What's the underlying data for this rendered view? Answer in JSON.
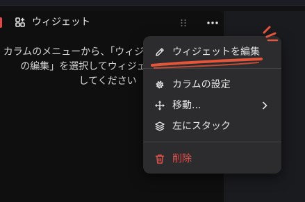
{
  "column": {
    "title": "ウィジェット",
    "message_line1": "カラムのメニューから、「ウィジェットを編集」",
    "message_line2": "の編集」を選択してウィジェットを追加",
    "message_line3": "してください"
  },
  "menu": {
    "items": [
      {
        "label": "ウィジェットを編集",
        "icon": "pencil-icon"
      },
      {
        "label": "カラムの設定",
        "icon": "gear-icon"
      },
      {
        "label": "移動...",
        "icon": "move-arrows-icon"
      },
      {
        "label": "左にスタック",
        "icon": "layers-icon"
      },
      {
        "label": "削除",
        "icon": "trash-icon"
      }
    ]
  },
  "colors": {
    "accent": "#e04848",
    "danger": "#e2504a",
    "annotation": "#e4553a",
    "menu_bg": "#2c2c2e"
  }
}
